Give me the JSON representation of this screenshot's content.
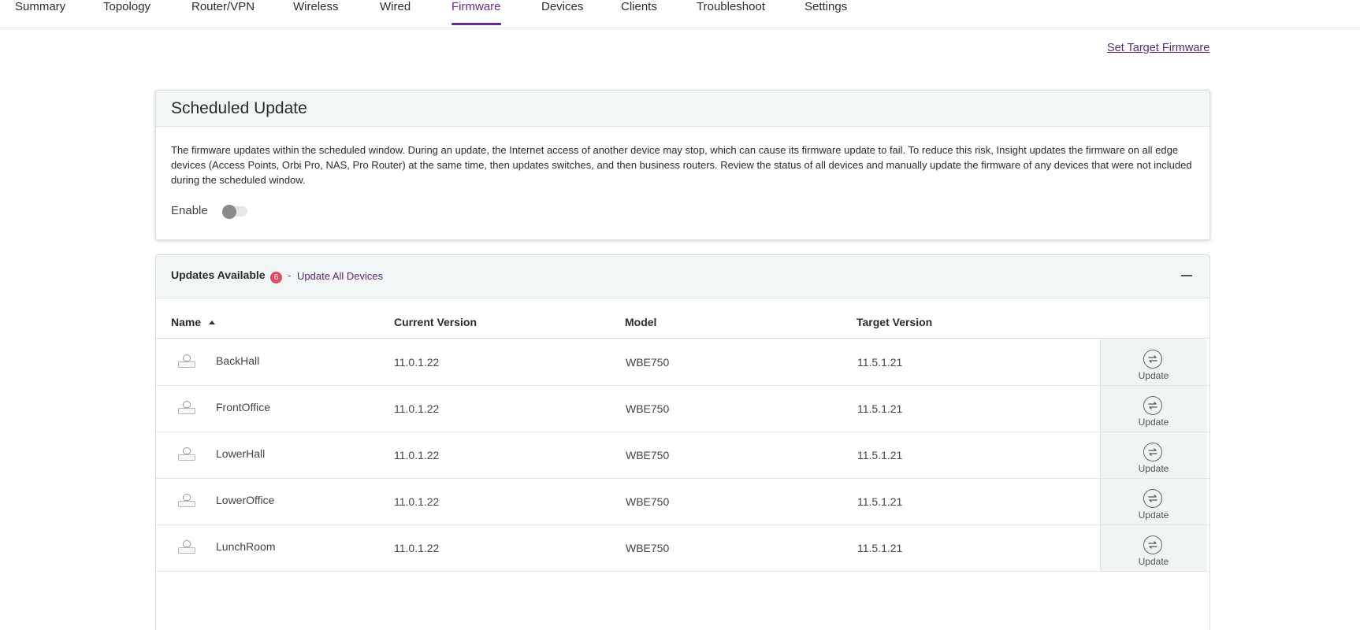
{
  "nav": {
    "tabs": [
      {
        "label": "Summary"
      },
      {
        "label": "Topology"
      },
      {
        "label": "Router/VPN"
      },
      {
        "label": "Wireless"
      },
      {
        "label": "Wired"
      },
      {
        "label": "Firmware"
      },
      {
        "label": "Devices"
      },
      {
        "label": "Clients"
      },
      {
        "label": "Troubleshoot"
      },
      {
        "label": "Settings"
      }
    ],
    "active": "Firmware"
  },
  "set_target_firmware": "Set Target Firmware",
  "scheduled": {
    "title": "Scheduled Update",
    "description": "The firmware updates within the scheduled window. During an update, the Internet access of another device may stop, which can cause its firmware update to fail. To reduce this risk, Insight updates the firmware on all edge devices (Access Points, Orbi Pro, NAS, Pro Router) at the same time, then updates switches, and then business routers. Review the status of all devices and manually update the firmware of any devices that were not included during the scheduled window.",
    "enable_label": "Enable",
    "enabled": false
  },
  "updates": {
    "title": "Updates Available",
    "count": "6",
    "separator": "-",
    "update_all_label": "Update All Devices",
    "columns": {
      "name": "Name",
      "current": "Current Version",
      "model": "Model",
      "target": "Target Version"
    },
    "action_label": "Update",
    "rows": [
      {
        "name": "BackHall",
        "current": "11.0.1.22",
        "model": "WBE750",
        "target": "11.5.1.21"
      },
      {
        "name": "FrontOffice",
        "current": "11.0.1.22",
        "model": "WBE750",
        "target": "11.5.1.21"
      },
      {
        "name": "LowerHall",
        "current": "11.0.1.22",
        "model": "WBE750",
        "target": "11.5.1.21"
      },
      {
        "name": "LowerOffice",
        "current": "11.0.1.22",
        "model": "WBE750",
        "target": "11.5.1.21"
      },
      {
        "name": "LunchRoom",
        "current": "11.0.1.22",
        "model": "WBE750",
        "target": "11.5.1.21"
      }
    ]
  },
  "colors": {
    "accent": "#6b2c87",
    "badge": "#e04b5e",
    "header_bg": "#f3f6f6"
  }
}
